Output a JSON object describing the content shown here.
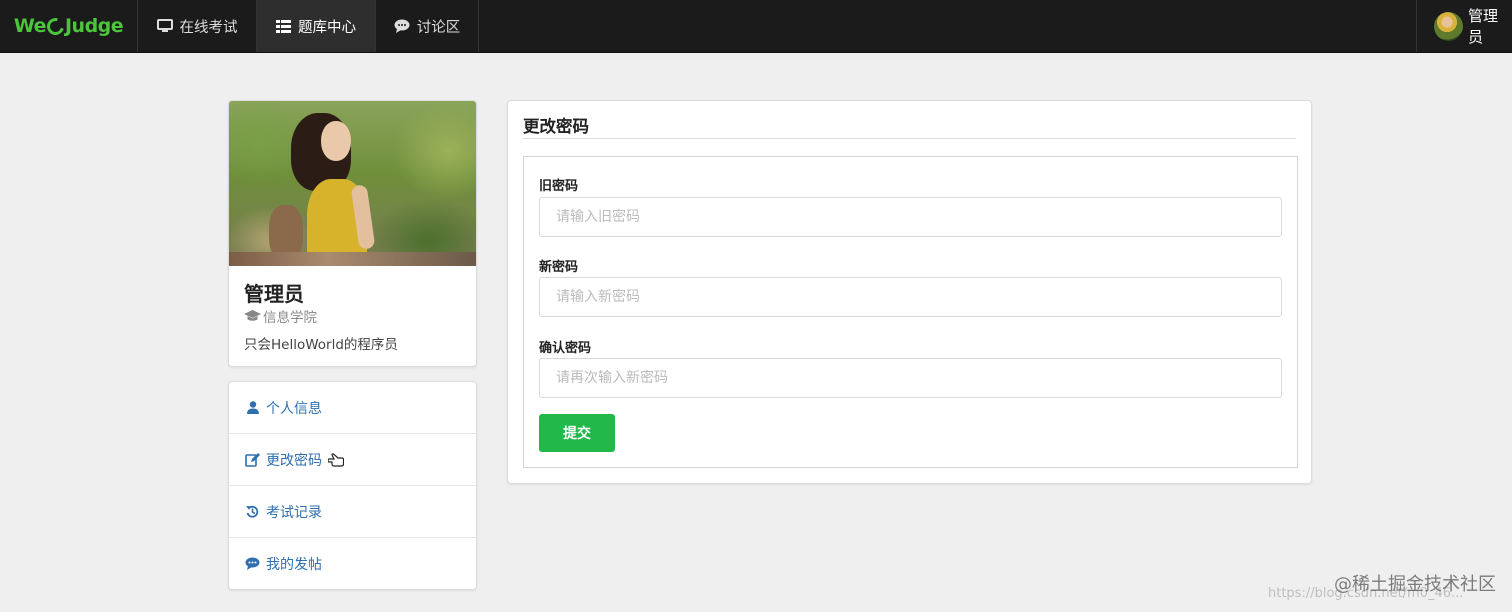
{
  "navbar": {
    "brand": {
      "prefix": "We",
      "suffix": "Judge"
    },
    "items": [
      {
        "label": "在线考试",
        "icon": "monitor-icon",
        "active": false
      },
      {
        "label": "题库中心",
        "icon": "list-icon",
        "active": true
      },
      {
        "label": "讨论区",
        "icon": "comment-icon",
        "active": false
      }
    ],
    "user": {
      "name": "管理员"
    }
  },
  "profile": {
    "name": "管理员",
    "department": "信息学院",
    "bio": "只会HelloWorld的程序员"
  },
  "menu": {
    "items": [
      {
        "label": "个人信息",
        "icon": "user-icon"
      },
      {
        "label": "更改密码",
        "icon": "edit-icon"
      },
      {
        "label": "考试记录",
        "icon": "history-icon"
      },
      {
        "label": "我的发帖",
        "icon": "comment-icon"
      }
    ]
  },
  "form": {
    "title": "更改密码",
    "old_password": {
      "label": "旧密码",
      "placeholder": "请输入旧密码",
      "value": ""
    },
    "new_password": {
      "label": "新密码",
      "placeholder": "请输入新密码",
      "value": ""
    },
    "confirm_password": {
      "label": "确认密码",
      "placeholder": "请再次输入新密码",
      "value": ""
    },
    "submit_label": "提交"
  },
  "watermark": {
    "main": "@稀土掘金技术社区",
    "url": "https://blog.csdn.net/m0_46..."
  },
  "colors": {
    "navbar_bg": "#1b1b1b",
    "brand_green": "#4cc43c",
    "link_blue": "#2f6fb0",
    "submit_green": "#22b84a",
    "page_bg": "#efefef"
  }
}
